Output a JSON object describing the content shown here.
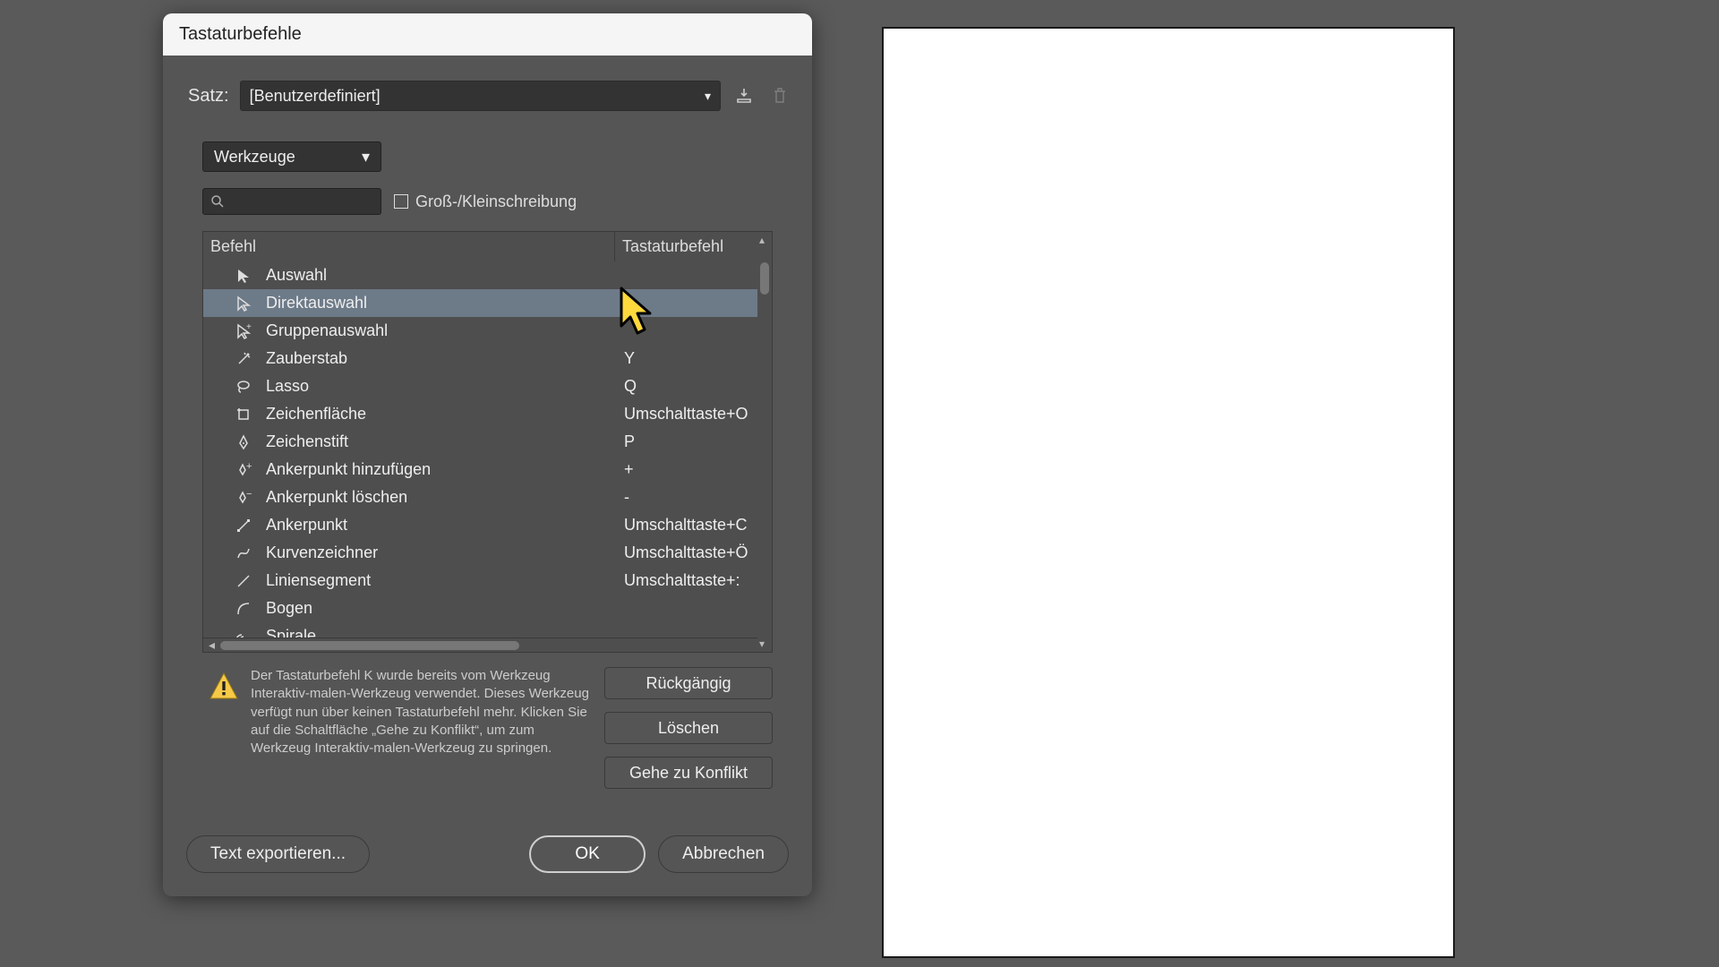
{
  "dialog": {
    "title": "Tastaturbefehle",
    "satz_label": "Satz:",
    "satz_value": "[Benutzerdefiniert]",
    "section_value": "Werkzeuge",
    "case_label": "Groß-/Kleinschreibung",
    "columns": {
      "c1": "Befehl",
      "c2": "Tastaturbefehl"
    },
    "rows": [
      {
        "icon": "selection-arrow",
        "name": "Auswahl",
        "key": ""
      },
      {
        "icon": "direct-arrow",
        "name": "Direktauswahl",
        "key": "",
        "selected": true
      },
      {
        "icon": "group-arrow",
        "name": "Gruppenauswahl",
        "key": ""
      },
      {
        "icon": "wand",
        "name": "Zauberstab",
        "key": "Y"
      },
      {
        "icon": "lasso",
        "name": "Lasso",
        "key": "Q"
      },
      {
        "icon": "artboard",
        "name": "Zeichenfläche",
        "key": "Umschalttaste+O"
      },
      {
        "icon": "pen",
        "name": "Zeichenstift",
        "key": "P"
      },
      {
        "icon": "pen-plus",
        "name": "Ankerpunkt hinzufügen",
        "key": "+"
      },
      {
        "icon": "pen-minus",
        "name": "Ankerpunkt löschen",
        "key": "-"
      },
      {
        "icon": "anchor",
        "name": "Ankerpunkt",
        "key": "Umschalttaste+C"
      },
      {
        "icon": "curve",
        "name": "Kurvenzeichner",
        "key": "Umschalttaste+Ö"
      },
      {
        "icon": "line",
        "name": "Liniensegment",
        "key": "Umschalttaste+:"
      },
      {
        "icon": "arc",
        "name": "Bogen",
        "key": ""
      },
      {
        "icon": "spiral",
        "name": "Spirale",
        "key": ""
      }
    ],
    "warning": "Der Tastaturbefehl K wurde bereits vom Werkzeug Interaktiv-malen-Werkzeug verwendet. Dieses Werkzeug verfügt nun über keinen Tastaturbefehl mehr. Klicken Sie auf die Schaltfläche „Gehe zu Konflikt“, um zum Werkzeug Interaktiv-malen-Werkzeug zu springen.",
    "buttons": {
      "undo": "Rückgängig",
      "clear": "Löschen",
      "conflict": "Gehe zu Konflikt",
      "export": "Text exportieren...",
      "ok": "OK",
      "cancel": "Abbrechen"
    }
  }
}
